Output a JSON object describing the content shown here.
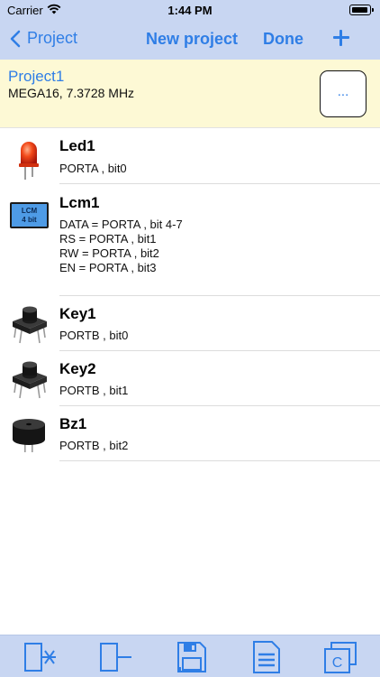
{
  "status": {
    "carrier": "Carrier",
    "time": "1:44 PM"
  },
  "nav": {
    "back_label": "Project",
    "title": "New project",
    "done_label": "Done"
  },
  "project": {
    "name": "Project1",
    "mcu": "MEGA16, 7.3728 MHz",
    "more_label": "..."
  },
  "devices": [
    {
      "name": "Led1",
      "lines": [
        "PORTA , bit0"
      ],
      "icon": "led-icon"
    },
    {
      "name": "Lcm1",
      "lines": [
        "DATA = PORTA , bit 4-7",
        "RS = PORTA , bit1",
        "RW = PORTA , bit2",
        "EN = PORTA , bit3"
      ],
      "icon": "lcm-icon",
      "icon_text": [
        "LCM",
        "4 bit"
      ]
    },
    {
      "name": "Key1",
      "lines": [
        "PORTB , bit0"
      ],
      "icon": "key-button-icon"
    },
    {
      "name": "Key2",
      "lines": [
        "PORTB , bit1"
      ],
      "icon": "key-button-icon"
    },
    {
      "name": "Bz1",
      "lines": [
        "PORTB , bit2"
      ],
      "icon": "buzzer-icon"
    }
  ],
  "toolbar": {
    "compile_icon_label": "C",
    "items": [
      "delete-device-icon",
      "add-device-icon",
      "save-icon",
      "document-icon",
      "compile-icon"
    ]
  },
  "colors": {
    "accent": "#2f7ee6",
    "bar_bg": "#c8d6f2",
    "project_bg": "#fdf9d5"
  }
}
